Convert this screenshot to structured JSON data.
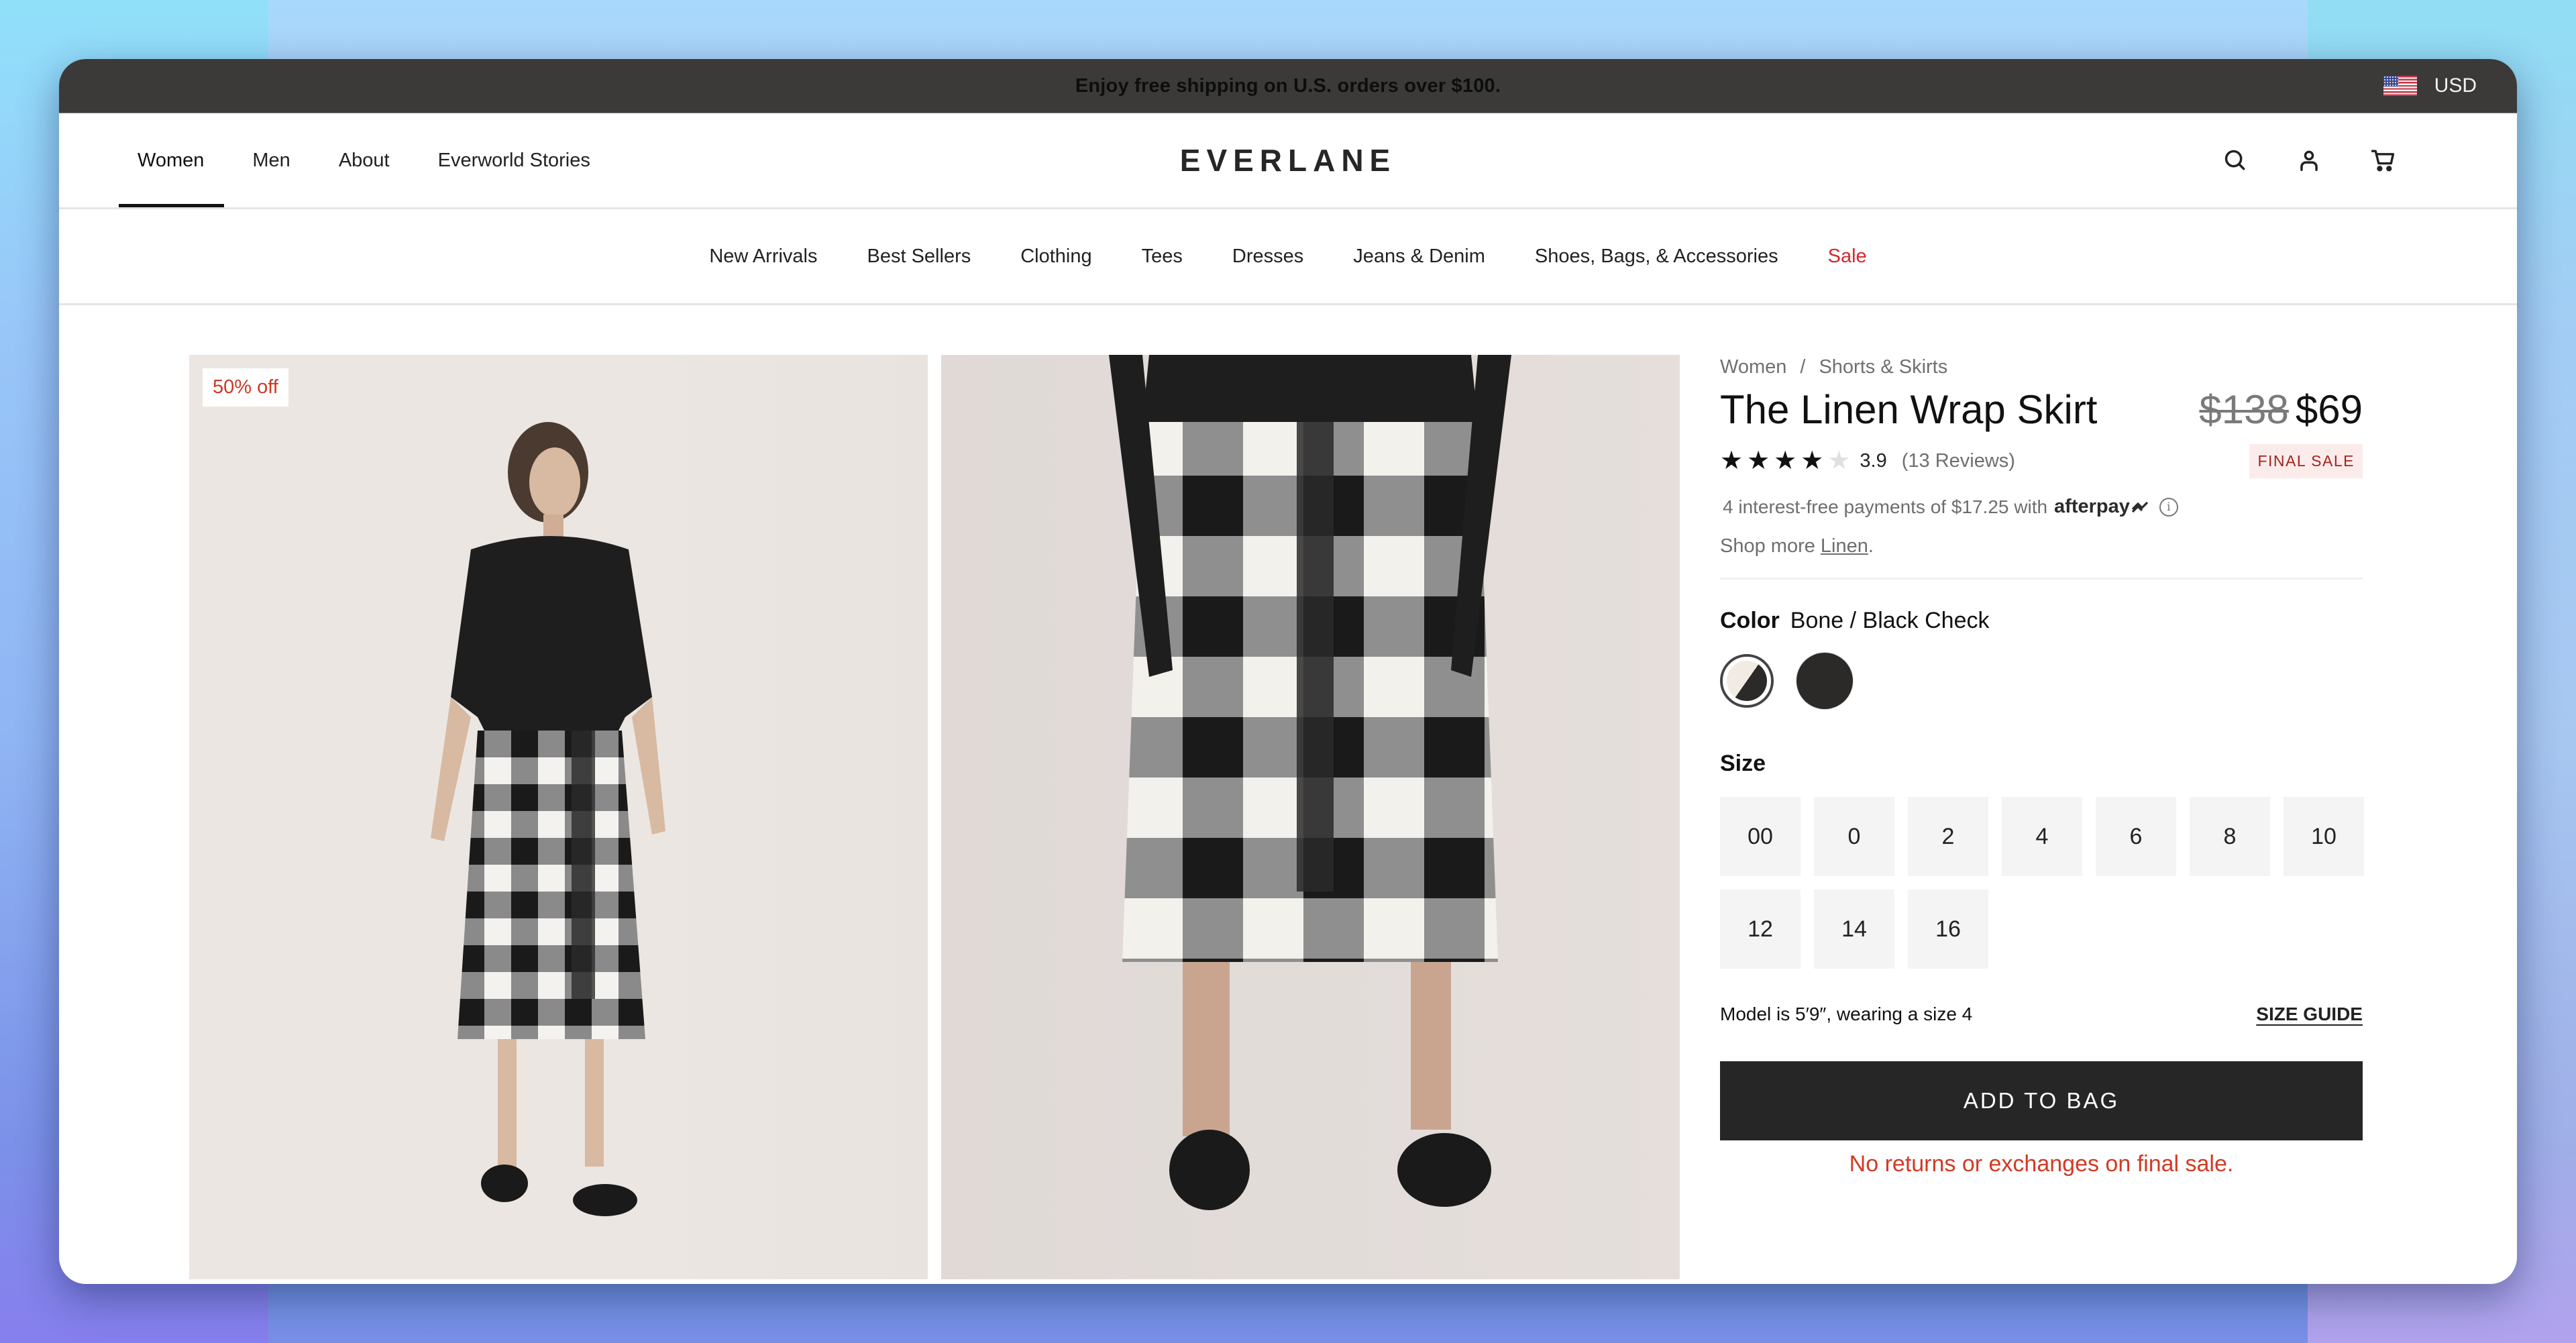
{
  "banner": {
    "text": "Enjoy free shipping on U.S. orders over $100.",
    "currency": "USD",
    "flag_icon": "us-flag-icon"
  },
  "main_nav": {
    "items": [
      {
        "label": "Women",
        "active": true
      },
      {
        "label": "Men",
        "active": false
      },
      {
        "label": "About",
        "active": false
      },
      {
        "label": "Everworld Stories",
        "active": false
      }
    ],
    "logo": "EVERLANE",
    "icons": [
      "search-icon",
      "account-icon",
      "cart-icon"
    ]
  },
  "category_nav": {
    "items": [
      {
        "label": "New Arrivals"
      },
      {
        "label": "Best Sellers"
      },
      {
        "label": "Clothing"
      },
      {
        "label": "Tees"
      },
      {
        "label": "Dresses"
      },
      {
        "label": "Jeans & Denim"
      },
      {
        "label": "Shoes, Bags, & Accessories"
      },
      {
        "label": "Sale",
        "highlight_color": "#d8262e"
      }
    ]
  },
  "gallery": {
    "discount_badge": "50% off",
    "images": [
      {
        "alt": "Model wearing black shirt and linen wrap skirt, full body"
      },
      {
        "alt": "Close-up of linen wrap skirt in bone and black check"
      }
    ]
  },
  "product": {
    "breadcrumb": [
      "Women",
      "Shorts & Skirts"
    ],
    "breadcrumb_separator": "/",
    "title": "The Linen Wrap Skirt",
    "original_price": "$138",
    "sale_price": "$69",
    "rating": {
      "value": "3.9",
      "stars_filled": 4,
      "stars_total": 5,
      "reviews": "(13 Reviews)"
    },
    "final_sale_badge": "FINAL SALE",
    "afterpay": {
      "text": "4 interest-free payments of $17.25 with",
      "brand": "afterpay"
    },
    "shop_more": {
      "prefix": "Shop more",
      "link": "Linen",
      "suffix": "."
    },
    "color": {
      "label": "Color",
      "selected": "Bone / Black Check",
      "swatches": [
        {
          "name": "Bone / Black Check",
          "colors": [
            "#f2ebe3",
            "#2b2a29"
          ],
          "selected": true
        },
        {
          "name": "Black",
          "colors": [
            "#2b2a29"
          ],
          "selected": false
        }
      ]
    },
    "size": {
      "label": "Size",
      "options": [
        "00",
        "0",
        "2",
        "4",
        "6",
        "8",
        "10",
        "12",
        "14",
        "16"
      ]
    },
    "model_info": "Model is 5′9″, wearing a size 4",
    "size_guide": "SIZE GUIDE",
    "add_to_bag": "ADD TO BAG",
    "no_returns": "No returns or exchanges on final sale."
  }
}
